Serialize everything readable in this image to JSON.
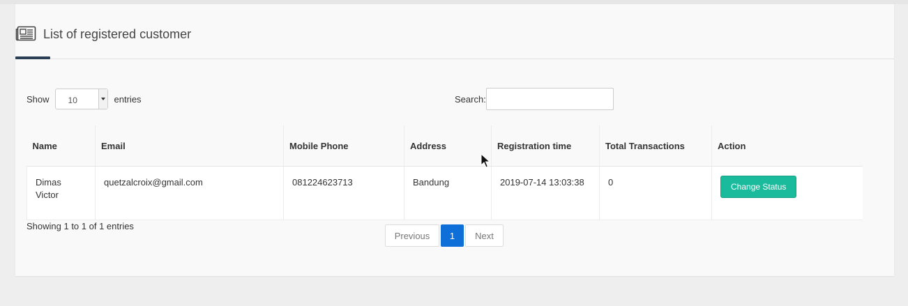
{
  "header": {
    "title": "List of registered customer",
    "icon": "newspaper-icon"
  },
  "length_menu": {
    "show_label": "Show",
    "selected": "10",
    "entries_label": "entries"
  },
  "search": {
    "label": "Search:",
    "value": ""
  },
  "table": {
    "columns": [
      "Name",
      "Email",
      "Mobile Phone",
      "Address",
      "Registration time",
      "Total Transactions",
      "Action"
    ],
    "rows": [
      {
        "name": "Dimas Victor",
        "email": "quetzalcroix@gmail.com",
        "phone": "081224623713",
        "address": "Bandung",
        "registration_time": "2019-07-14 13:03:38",
        "total_transactions": "0",
        "action_label": "Change Status"
      }
    ]
  },
  "info_text": "Showing 1 to 1 of 1 entries",
  "pagination": {
    "previous": "Previous",
    "current": "1",
    "next": "Next"
  },
  "colors": {
    "accent_button": "#1abb9c",
    "page_active": "#0d6fd7",
    "header_accent": "#2a3f54"
  }
}
